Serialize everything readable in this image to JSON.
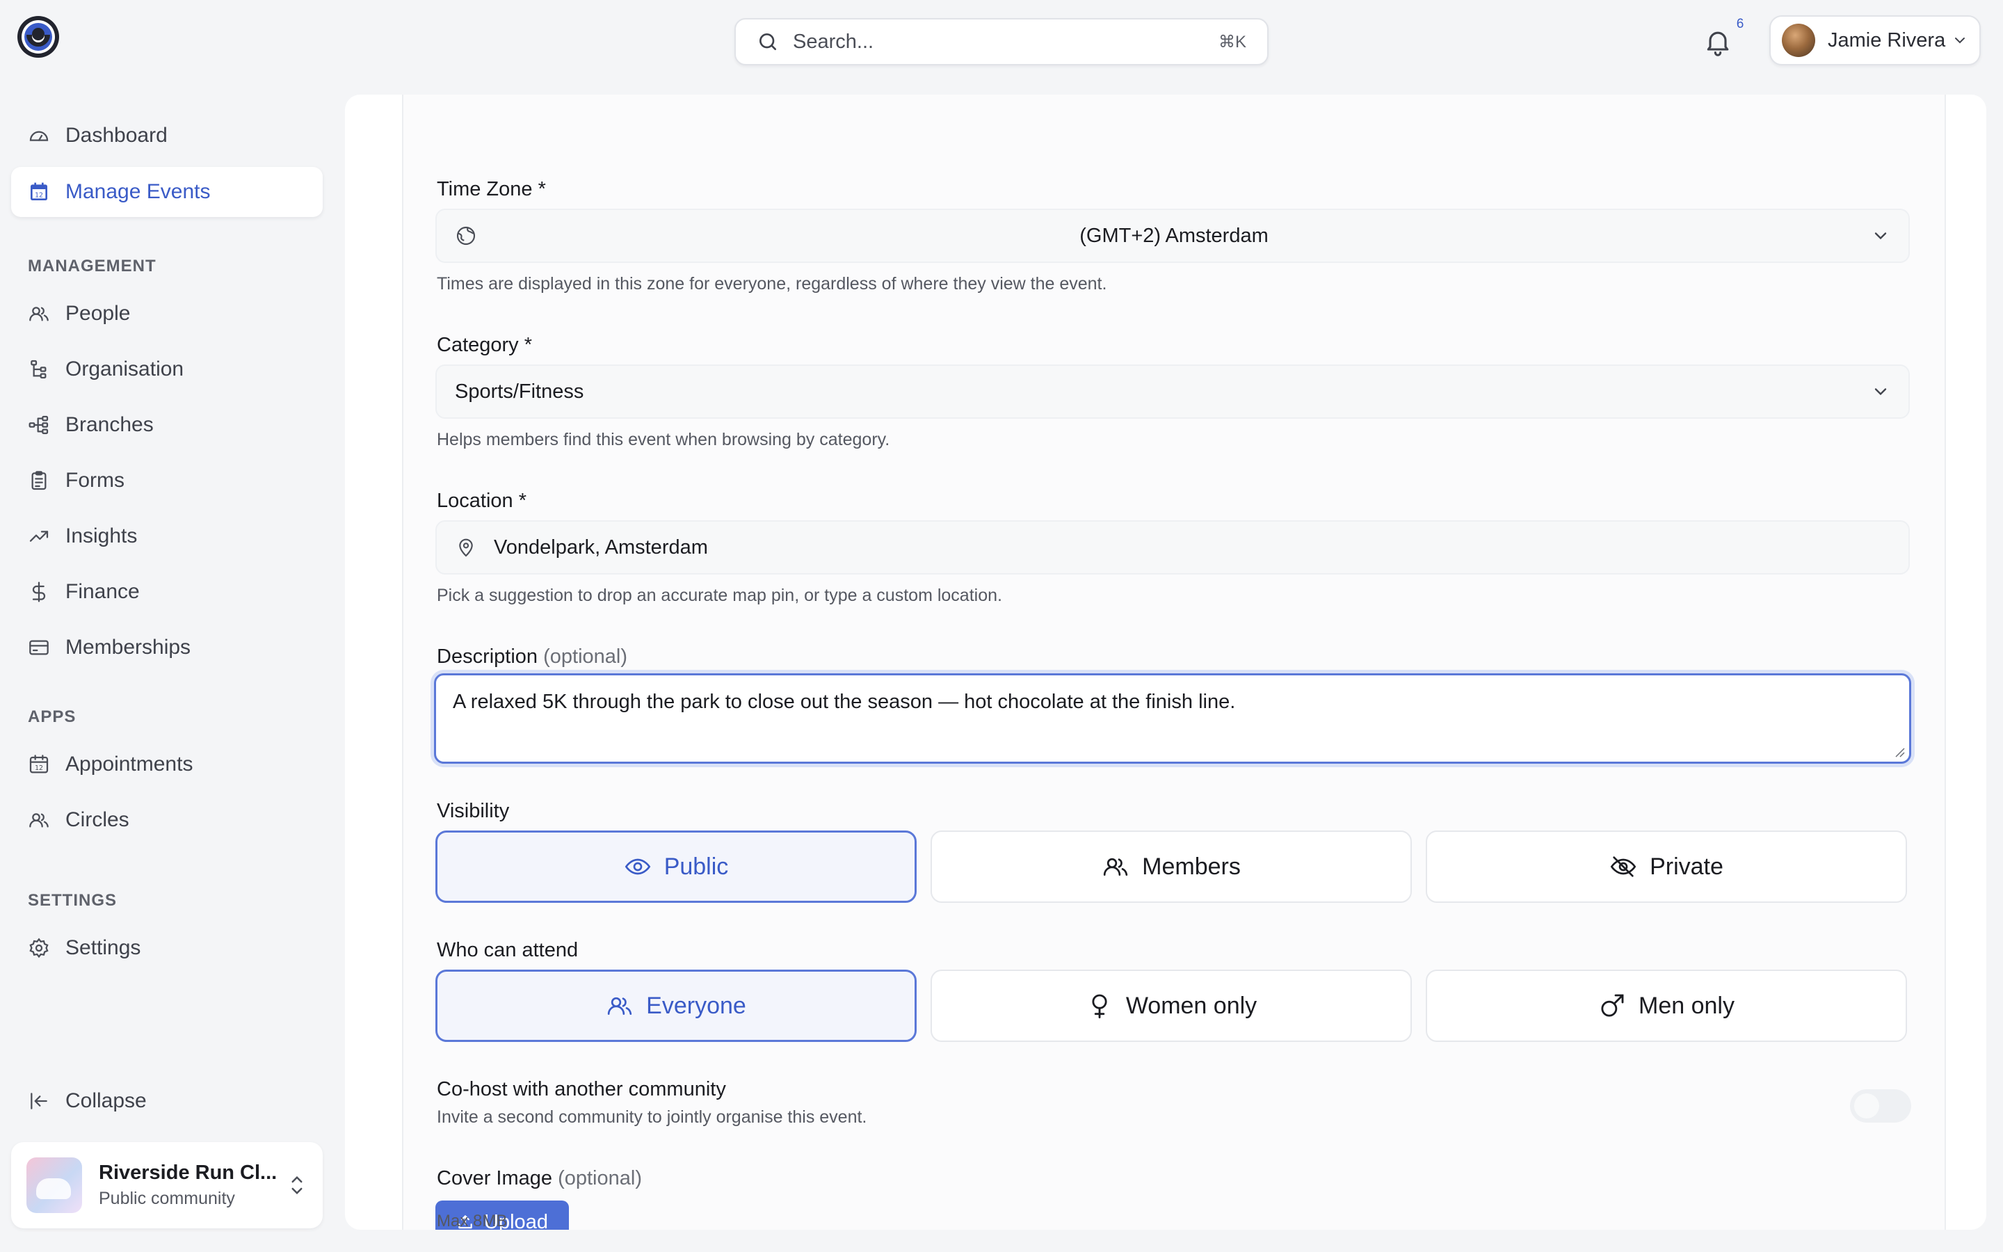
{
  "colors": {
    "accent": "#3a5bc7",
    "accent_border": "#5b78d8",
    "upload_bg": "#4d6fd6"
  },
  "header": {
    "search_placeholder": "Search...",
    "search_shortcut": "⌘K",
    "notification_count": "6",
    "user_name": "Jamie Rivera"
  },
  "sidebar": {
    "top_items": [
      {
        "label": "Dashboard",
        "icon": "gauge-icon"
      },
      {
        "label": "Manage Events",
        "icon": "calendar-icon",
        "active": true
      }
    ],
    "sections": {
      "management": "MANAGEMENT",
      "apps": "APPS",
      "settings": "SETTINGS"
    },
    "management_items": [
      {
        "label": "People",
        "icon": "users-icon"
      },
      {
        "label": "Organisation",
        "icon": "hierarchy-icon"
      },
      {
        "label": "Branches",
        "icon": "branches-icon"
      },
      {
        "label": "Forms",
        "icon": "clipboard-icon"
      },
      {
        "label": "Insights",
        "icon": "trend-icon"
      },
      {
        "label": "Finance",
        "icon": "dollar-icon"
      },
      {
        "label": "Memberships",
        "icon": "card-icon"
      }
    ],
    "app_items": [
      {
        "label": "Appointments",
        "icon": "calendar-icon"
      },
      {
        "label": "Circles",
        "icon": "users-icon"
      }
    ],
    "settings_items": [
      {
        "label": "Settings",
        "icon": "gear-icon"
      }
    ],
    "collapse_label": "Collapse",
    "community": {
      "name": "Riverside Run Cl...",
      "type": "Public community"
    }
  },
  "form": {
    "timezone": {
      "label": "Time Zone *",
      "value": "(GMT+2) Amsterdam",
      "hint": "Times are displayed in this zone for everyone, regardless of where they view the event."
    },
    "category": {
      "label": "Category *",
      "value": "Sports/Fitness",
      "hint": "Helps members find this event when browsing by category."
    },
    "location": {
      "label": "Location *",
      "value": "Vondelpark, Amsterdam",
      "hint": "Pick a suggestion to drop an accurate map pin, or type a custom location."
    },
    "description": {
      "label": "Description",
      "optional": "(optional)",
      "value": "A relaxed 5K through the park to close out the season — hot chocolate at the finish line."
    },
    "visibility": {
      "label": "Visibility",
      "options": [
        "Public",
        "Members",
        "Private"
      ],
      "selected": "Public"
    },
    "attend": {
      "label": "Who can attend",
      "options": [
        "Everyone",
        "Women only",
        "Men only"
      ],
      "selected": "Everyone"
    },
    "cohost": {
      "label": "Co-host with another community",
      "hint": "Invite a second community to jointly organise this event.",
      "enabled": false
    },
    "cover": {
      "label": "Cover Image",
      "optional": "(optional)",
      "upload_label": "Upload",
      "hint": "Max 8MB"
    }
  }
}
